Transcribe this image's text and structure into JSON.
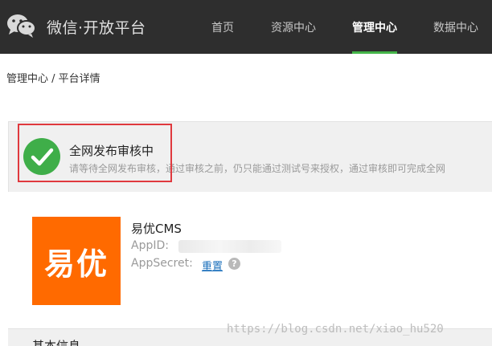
{
  "header": {
    "brand": "微信·开放平台",
    "logo_icon": "wechat-logo-icon",
    "nav": [
      {
        "label": "首页",
        "active": false
      },
      {
        "label": "资源中心",
        "active": false
      },
      {
        "label": "管理中心",
        "active": true
      },
      {
        "label": "数据中心",
        "active": false
      }
    ]
  },
  "breadcrumb": "管理中心 / 平台详情",
  "status": {
    "icon": "checkmark-circle-icon",
    "color": "#3fae49",
    "highlight_color": "#e0393e",
    "title": "全网发布审核中",
    "description": "请等待全网发布审核，通过审核之前，仍只能通过测试号来授权，通过审核即可完成全网"
  },
  "app": {
    "logo_text": "易优",
    "logo_color": "#ff6a00",
    "name": "易优CMS",
    "appid_label": "AppID:",
    "appsecret_label": "AppSecret:",
    "reset_link": "重置",
    "help_icon": "question-mark-icon"
  },
  "basic_info": {
    "title": "基本信息"
  },
  "watermark": "https://blog.csdn.net/xiao_hu520",
  "colors": {
    "topbar": "#2e2e2e",
    "nav_active_underline": "#44b549",
    "link": "#1a6fbb"
  }
}
